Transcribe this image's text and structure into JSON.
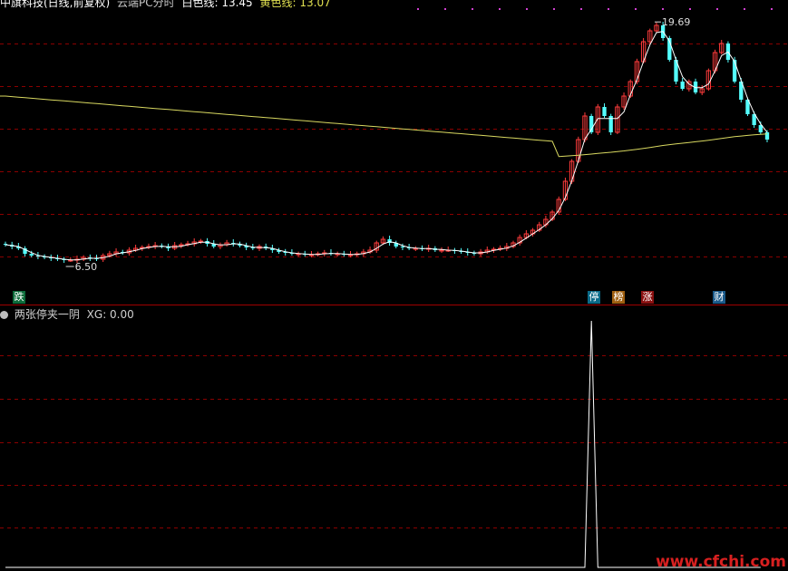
{
  "header": {
    "stock_name": "中旗科技(日线,前复权)",
    "indicator": "云端PC分时",
    "ma_label": "白色线: 13.45",
    "ma2_label": "黄色线: 13.07"
  },
  "indicator_header": {
    "name": "两张停夹一阴",
    "value_label": "XG: 0.00"
  },
  "badges": {
    "die": "跌",
    "ting": "停",
    "bang": "榜",
    "zhang": "涨",
    "cai": "财"
  },
  "annotations": {
    "high": "19.69",
    "low": "6.50"
  },
  "watermark": "www.cfchi.com",
  "colors": {
    "up": "#ff3c3c",
    "down": "#54ffff",
    "ma_white": "#ffffff",
    "ma_yellow": "#d8d860",
    "grid": "#8b0000",
    "signal": "#ffffff"
  },
  "chart_data": [
    {
      "type": "candlestick",
      "title": "中旗科技(日线,前复权)",
      "ylim": [
        5.0,
        20.5
      ],
      "grid": true,
      "series": [
        {
          "name": "price",
          "values": [
            7.4,
            7.3,
            7.2,
            6.9,
            6.8,
            6.75,
            6.7,
            6.65,
            6.6,
            6.55,
            6.55,
            6.6,
            6.7,
            6.65,
            6.6,
            6.8,
            6.9,
            7.0,
            6.95,
            7.1,
            7.2,
            7.25,
            7.3,
            7.35,
            7.3,
            7.2,
            7.35,
            7.4,
            7.45,
            7.55,
            7.6,
            7.45,
            7.3,
            7.4,
            7.5,
            7.45,
            7.35,
            7.25,
            7.2,
            7.3,
            7.2,
            7.1,
            7.0,
            6.95,
            6.9,
            6.9,
            6.85,
            6.85,
            6.9,
            6.95,
            6.9,
            6.9,
            6.85,
            6.85,
            6.9,
            7.0,
            7.1,
            7.5,
            7.7,
            7.5,
            7.3,
            7.25,
            7.2,
            7.2,
            7.15,
            7.2,
            7.1,
            7.1,
            7.1,
            7.05,
            7.0,
            6.95,
            6.9,
            7.0,
            7.1,
            7.15,
            7.2,
            7.3,
            7.5,
            7.8,
            8.0,
            8.2,
            8.5,
            8.8,
            9.2,
            9.9,
            10.9,
            12.0,
            13.2,
            14.5,
            13.6,
            15.0,
            14.5,
            13.6,
            15.0,
            15.6,
            16.4,
            17.5,
            18.6,
            19.2,
            19.5,
            18.8,
            17.6,
            16.4,
            16.0,
            16.4,
            15.8,
            16.0,
            17.0,
            18.0,
            18.5,
            17.6,
            16.4,
            15.4,
            14.6,
            14.0,
            13.6,
            13.2
          ]
        },
        {
          "name": "白色线",
          "values": []
        },
        {
          "name": "黄色线",
          "values": []
        }
      ]
    },
    {
      "type": "line",
      "series": [
        {
          "name": "XG",
          "values": [
            0,
            0,
            0,
            0,
            0,
            0,
            0,
            0,
            0,
            0,
            0,
            0,
            0,
            0,
            0,
            0,
            0,
            0,
            0,
            0,
            0,
            0,
            0,
            0,
            0,
            0,
            0,
            0,
            0,
            0,
            0,
            0,
            0,
            0,
            0,
            0,
            0,
            0,
            0,
            0,
            0,
            0,
            0,
            0,
            0,
            0,
            0,
            0,
            0,
            0,
            0,
            0,
            0,
            0,
            0,
            0,
            0,
            0,
            0,
            0,
            0,
            0,
            0,
            0,
            0,
            0,
            0,
            0,
            0,
            0,
            0,
            0,
            0,
            0,
            0,
            0,
            0,
            0,
            0,
            0,
            0,
            0,
            0,
            0,
            0,
            0,
            0,
            0,
            0,
            0,
            1,
            0,
            0,
            0,
            0,
            0,
            0,
            0,
            0,
            0,
            0,
            0,
            0,
            0,
            0,
            0,
            0,
            0,
            0,
            0,
            0,
            0,
            0,
            0,
            0,
            0,
            0
          ]
        }
      ]
    }
  ]
}
